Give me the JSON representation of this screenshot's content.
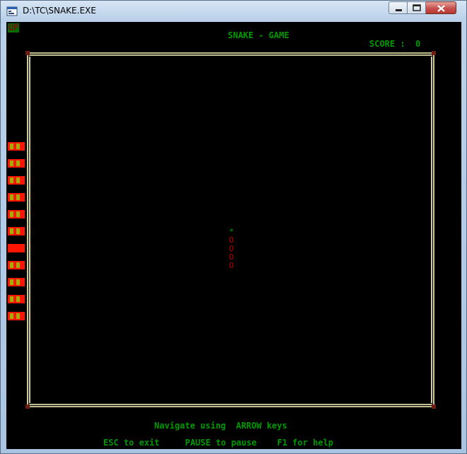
{
  "window": {
    "title": "D:\\TC\\SNAKE.EXE"
  },
  "game": {
    "up_label": "UP",
    "title": "SNAKE - GAME",
    "score_label": "SCORE :",
    "score": "0",
    "lives": 11,
    "snake": {
      "head": "*",
      "body": [
        "O",
        "O",
        "O",
        "O"
      ]
    },
    "footer_line1": "Navigate using  ARROW keys",
    "footer_line2": "ESC to exit     PAUSE to pause    F1 for help"
  },
  "colors": {
    "console_bg": "#000000",
    "text": "#009a00",
    "border": "#fffec0",
    "life_block": "#ff1400",
    "snake_head": "#00a000",
    "snake_body": "#c00000"
  },
  "icons": [
    "app-icon",
    "minimize-icon",
    "maximize-icon",
    "close-icon"
  ]
}
